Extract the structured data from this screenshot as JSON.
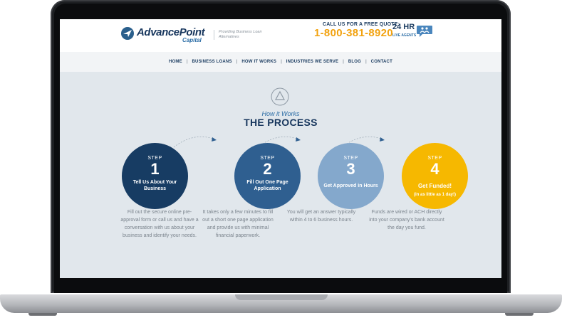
{
  "header": {
    "logo_name": "AdvancePoint",
    "logo_sub": "Capital",
    "tagline": "Providing Business Loan Alternatives",
    "call_label": "CALL US FOR A FREE QUOTE:",
    "phone": "1-800-381-8920",
    "hours": "24 HR",
    "live_agents": "LIVE AGENTS"
  },
  "nav": {
    "items": [
      "HOME",
      "BUSINESS LOANS",
      "HOW IT WORKS",
      "INDUSTRIES WE SERVE",
      "BLOG",
      "CONTACT"
    ],
    "separator": "|"
  },
  "section": {
    "eyebrow": "How it Works",
    "title": "THE PROCESS"
  },
  "steps": [
    {
      "label": "STEP",
      "number": "1",
      "title": "Tell Us About Your Business",
      "note": "",
      "color": "#173c63",
      "description": "Fill out the secure online pre-approval form or call us and have a conversation with us about your business and identify your needs."
    },
    {
      "label": "STEP",
      "number": "2",
      "title": "Fill Out One Page Application",
      "note": "",
      "color": "#2f5f90",
      "description": "It takes only a few minutes to fill out a short one page application and provide us with minimal financial paperwork."
    },
    {
      "label": "STEP",
      "number": "3",
      "title": "Get Approved in Hours",
      "note": "",
      "color": "#84a8cc",
      "description": "You will get an answer typically within 4 to 6 business hours."
    },
    {
      "label": "STEP",
      "number": "4",
      "title": "Get Funded!",
      "note": "(in as little as 1 day!)",
      "color": "#f6b800",
      "description": "Funds are wired or ACH directly into your company's bank account the day you fund."
    }
  ],
  "icons": {
    "logo": "advancepoint-logo-icon",
    "chat": "chat-bubble-icon",
    "process": "recycle-triangle-icon"
  }
}
